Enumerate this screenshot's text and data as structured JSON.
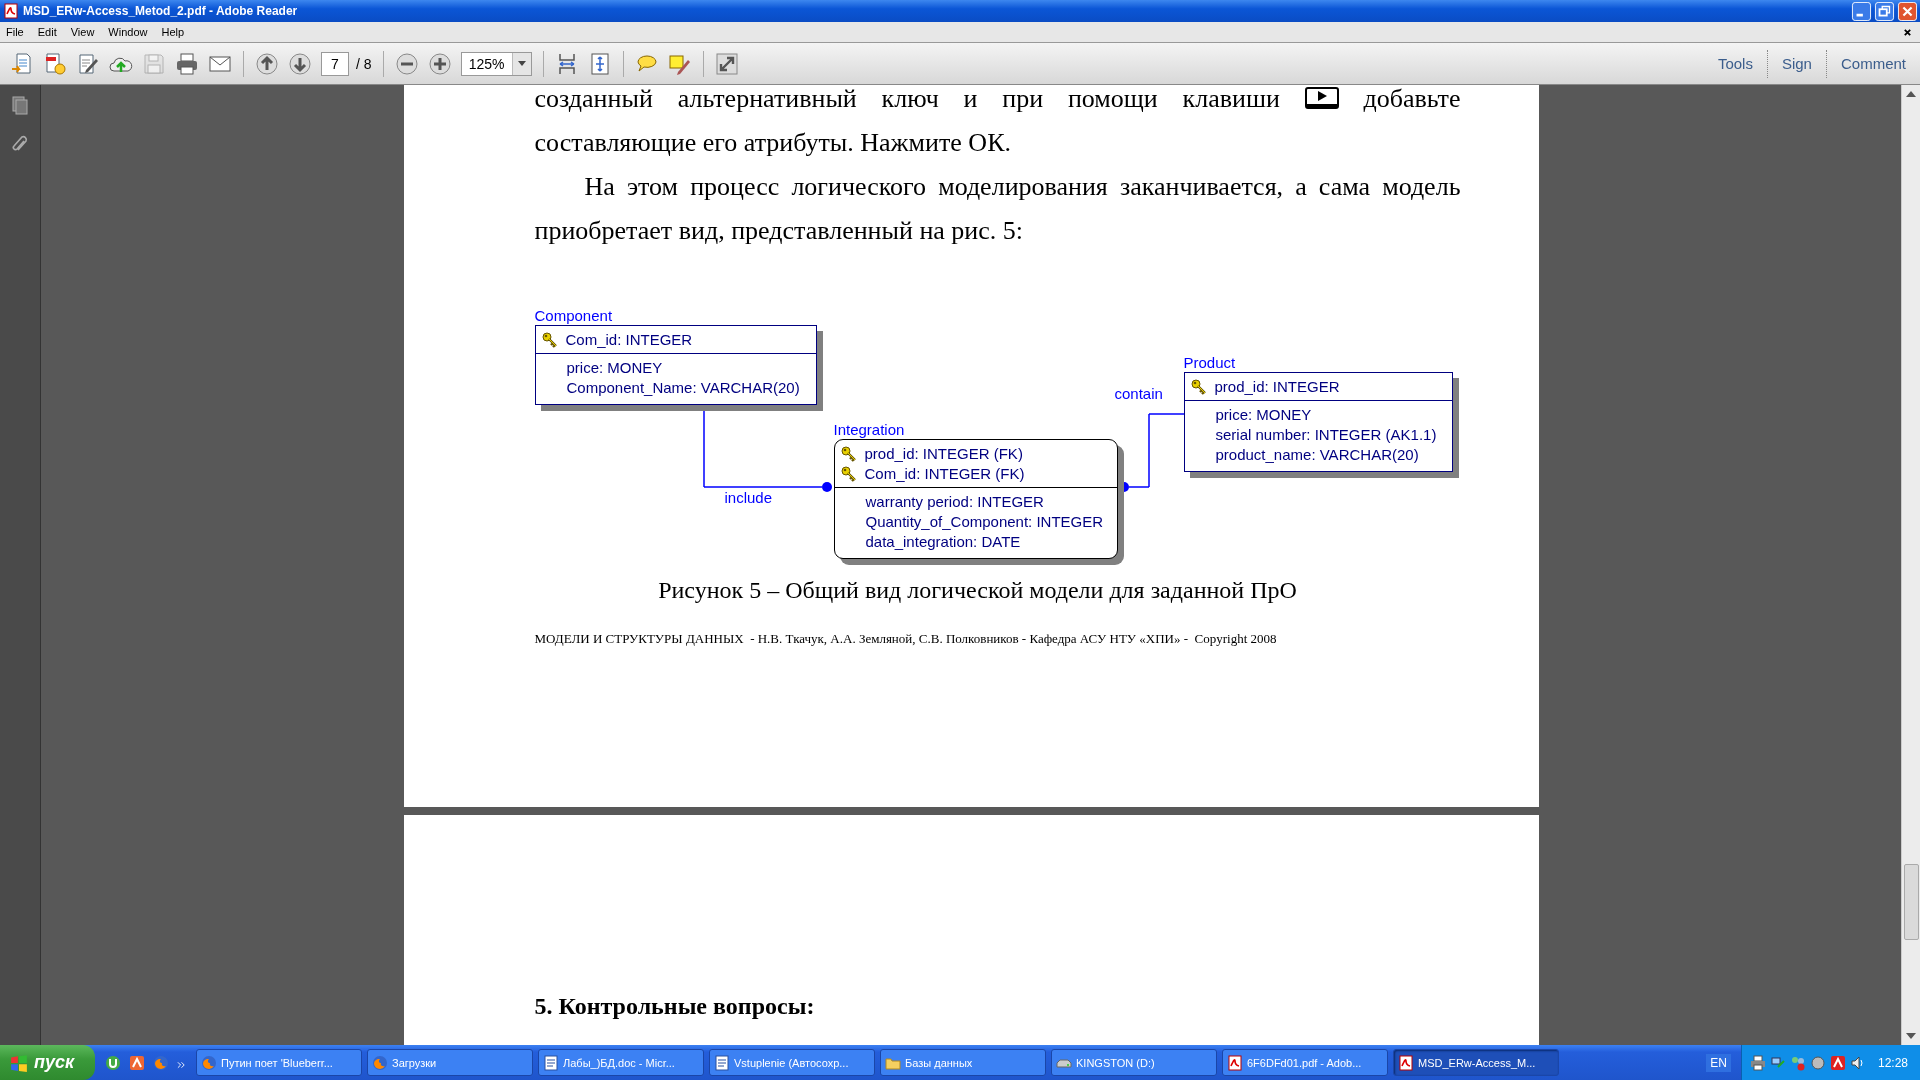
{
  "window": {
    "title": "MSD_ERw-Access_Metod_2.pdf - Adobe Reader"
  },
  "menu": [
    "File",
    "Edit",
    "View",
    "Window",
    "Help"
  ],
  "toolbar": {
    "page_number": "7",
    "page_count": "/ 8",
    "zoom": "125%",
    "save_disabled": true
  },
  "panel_buttons": [
    "Tools",
    "Sign",
    "Comment"
  ],
  "document": {
    "paragraphs": [
      {
        "kind": "key_inline",
        "indent": false,
        "before": "созданный альтернативный ключ и при помощи клавиши",
        "after": "добавьте составляющие его атрибуты. Нажмите ОК."
      },
      {
        "kind": "text",
        "indent": true,
        "text": "На этом процесс логического моделирования заканчивается, а сама модель приобретает вид, представленный на рис. 5:"
      }
    ],
    "diagram": {
      "entities": [
        {
          "name": "Component",
          "kind": "independent",
          "keys": [
            "Com_id: INTEGER"
          ],
          "attributes": [
            "price: MONEY",
            "Component_Name: VARCHAR(20)"
          ]
        },
        {
          "name": "Integration",
          "kind": "dependent",
          "keys": [
            "prod_id: INTEGER (FK)",
            "Com_id: INTEGER (FK)"
          ],
          "attributes": [
            "warranty period: INTEGER",
            "Quantity_of_Component: INTEGER",
            "data_integration: DATE"
          ]
        },
        {
          "name": "Product",
          "kind": "independent",
          "keys": [
            "prod_id: INTEGER"
          ],
          "attributes": [
            "price: MONEY",
            "serial number: INTEGER (AK1.1)",
            "product_name: VARCHAR(20)"
          ]
        }
      ],
      "relationships": [
        {
          "label": "include"
        },
        {
          "label": "contain"
        }
      ]
    },
    "caption": "Рисунок 5 – Общий вид логической модели для заданной ПрО",
    "footer": "МОДЕЛИ И СТРУКТУРЫ ДАННЫХ  - Н.В. Ткачук, А.А. Земляной, С.В. Полковников - Кафедра АСУ НТУ «ХПИ» -  Copyright 2008",
    "next_page": {
      "heading": "5. Контрольные вопросы:"
    }
  },
  "taskbar": {
    "start": "пуск",
    "tasks": [
      {
        "label": "Путин поет 'Blueberr...",
        "kind": "browser",
        "selected": false
      },
      {
        "label": "Загрузки",
        "kind": "browser",
        "selected": false
      },
      {
        "label": "Лабы_)БД.doc - Micr...",
        "kind": "word",
        "selected": false
      },
      {
        "label": "Vstuplenie (Автосохр...",
        "kind": "word",
        "selected": false
      },
      {
        "label": "Базы данных",
        "kind": "folder",
        "selected": false
      },
      {
        "label": "KINGSTON (D:)",
        "kind": "drive",
        "selected": false
      },
      {
        "label": "6F6DFd01.pdf - Adob...",
        "kind": "pdf",
        "selected": false
      },
      {
        "label": "MSD_ERw-Access_M...",
        "kind": "pdf",
        "selected": true
      }
    ],
    "language": "EN",
    "clock": "12:28"
  }
}
